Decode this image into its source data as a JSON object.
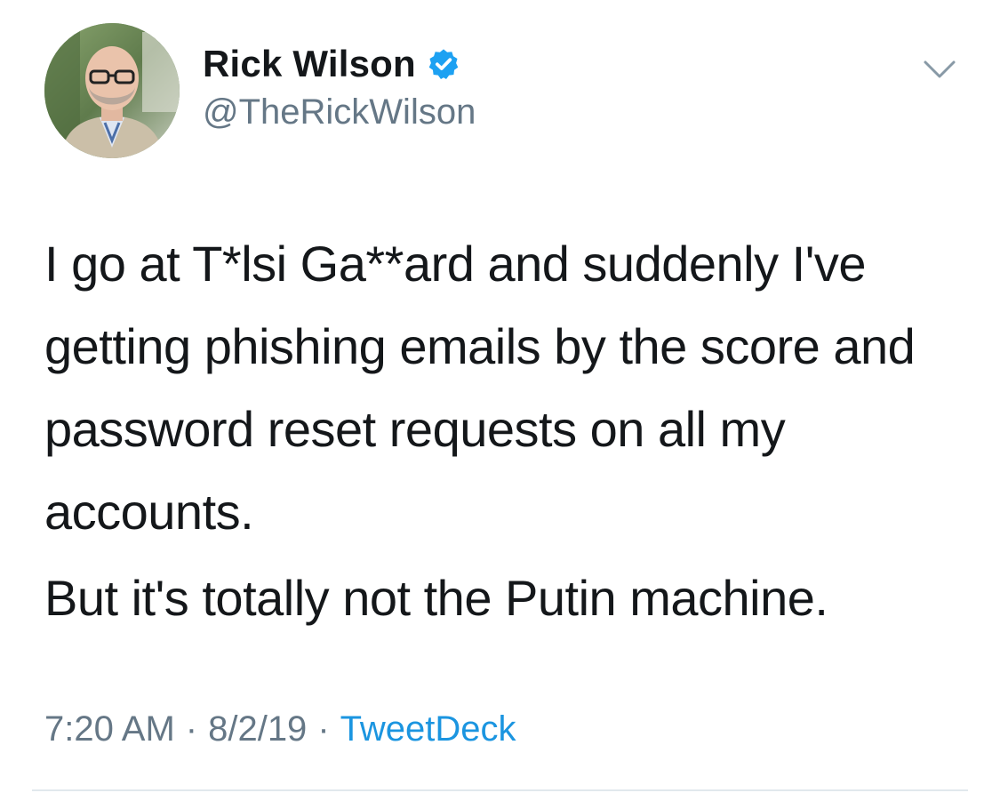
{
  "author": {
    "display_name": "Rick Wilson",
    "handle": "@TheRickWilson",
    "verified": true,
    "avatar_icon": "profile-photo"
  },
  "tweet": {
    "paragraphs": [
      "I go at T*lsi Ga**ard and suddenly I've getting phishing emails by the score and password reset requests on all my accounts.",
      "But it's totally not the Putin machine."
    ]
  },
  "meta": {
    "time": "7:20 AM",
    "separator": "·",
    "date": "8/2/19",
    "source": "TweetDeck"
  },
  "icons": {
    "verified": "verified-badge-icon",
    "menu": "chevron-down-icon"
  },
  "colors": {
    "text": "#14171a",
    "secondary": "#657786",
    "link": "#1b95e0",
    "verified": "#1da1f2",
    "divider": "#e1e8ed"
  }
}
